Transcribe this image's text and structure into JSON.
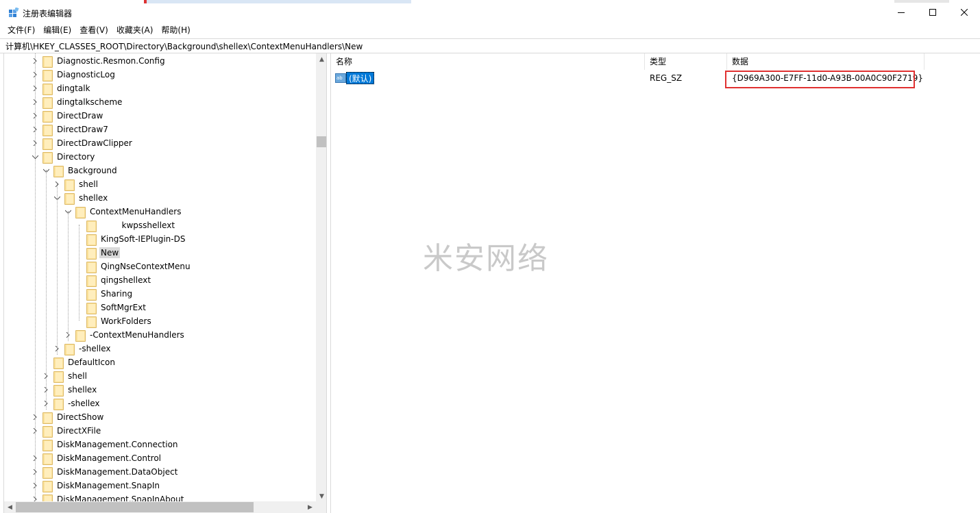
{
  "window": {
    "title": "注册表编辑器",
    "controls": [
      "minimize",
      "maximize",
      "close"
    ]
  },
  "menu": {
    "items": [
      "文件(F)",
      "编辑(E)",
      "查看(V)",
      "收藏夹(A)",
      "帮助(H)"
    ]
  },
  "address": {
    "value": "计算机\\HKEY_CLASSES_ROOT\\Directory\\Background\\shellex\\ContextMenuHandlers\\New"
  },
  "tree": {
    "items": [
      {
        "label": "Diagnostic.Resmon.Config",
        "expander": "collapsed"
      },
      {
        "label": "DiagnosticLog",
        "expander": "collapsed"
      },
      {
        "label": "dingtalk",
        "expander": "collapsed"
      },
      {
        "label": "dingtalkscheme",
        "expander": "collapsed"
      },
      {
        "label": "DirectDraw",
        "expander": "collapsed"
      },
      {
        "label": "DirectDraw7",
        "expander": "collapsed"
      },
      {
        "label": "DirectDrawClipper",
        "expander": "collapsed"
      },
      {
        "label": "Directory",
        "expander": "expanded"
      },
      {
        "label": "Background",
        "expander": "expanded"
      },
      {
        "label": "shell",
        "expander": "collapsed"
      },
      {
        "label": "shellex",
        "expander": "expanded"
      },
      {
        "label": "ContextMenuHandlers",
        "expander": "expanded"
      },
      {
        "label": "        kwpsshellext",
        "expander": "none"
      },
      {
        "label": "KingSoft-IEPlugin-DS",
        "expander": "none"
      },
      {
        "label": "New",
        "expander": "none",
        "selected": true
      },
      {
        "label": "QingNseContextMenu",
        "expander": "none"
      },
      {
        "label": "qingshellext",
        "expander": "none"
      },
      {
        "label": "Sharing",
        "expander": "none"
      },
      {
        "label": "SoftMgrExt",
        "expander": "none"
      },
      {
        "label": "WorkFolders",
        "expander": "none"
      },
      {
        "label": "-ContextMenuHandlers",
        "expander": "collapsed"
      },
      {
        "label": "-shellex",
        "expander": "collapsed"
      },
      {
        "label": "DefaultIcon",
        "expander": "none"
      },
      {
        "label": "shell",
        "expander": "collapsed"
      },
      {
        "label": "shellex",
        "expander": "collapsed"
      },
      {
        "label": "-shellex",
        "expander": "collapsed"
      },
      {
        "label": "DirectShow",
        "expander": "collapsed"
      },
      {
        "label": "DirectXFile",
        "expander": "collapsed"
      },
      {
        "label": "DiskManagement.Connection",
        "expander": "none"
      },
      {
        "label": "DiskManagement.Control",
        "expander": "collapsed"
      },
      {
        "label": "DiskManagement.DataObject",
        "expander": "collapsed"
      },
      {
        "label": "DiskManagement.SnapIn",
        "expander": "collapsed"
      },
      {
        "label": "DiskManagement.SnapInAbout",
        "expander": "collapsed"
      }
    ]
  },
  "list": {
    "columns": [
      "名称",
      "类型",
      "数据"
    ],
    "rows": [
      {
        "name": "(默认)",
        "type": "REG_SZ",
        "data": "{D969A300-E7FF-11d0-A93B-00A0C90F2719}"
      }
    ]
  },
  "watermark": "米安网络",
  "colors": {
    "selection": "#0078d7",
    "highlight_box": "#e03030",
    "folder": "#fce29b"
  }
}
